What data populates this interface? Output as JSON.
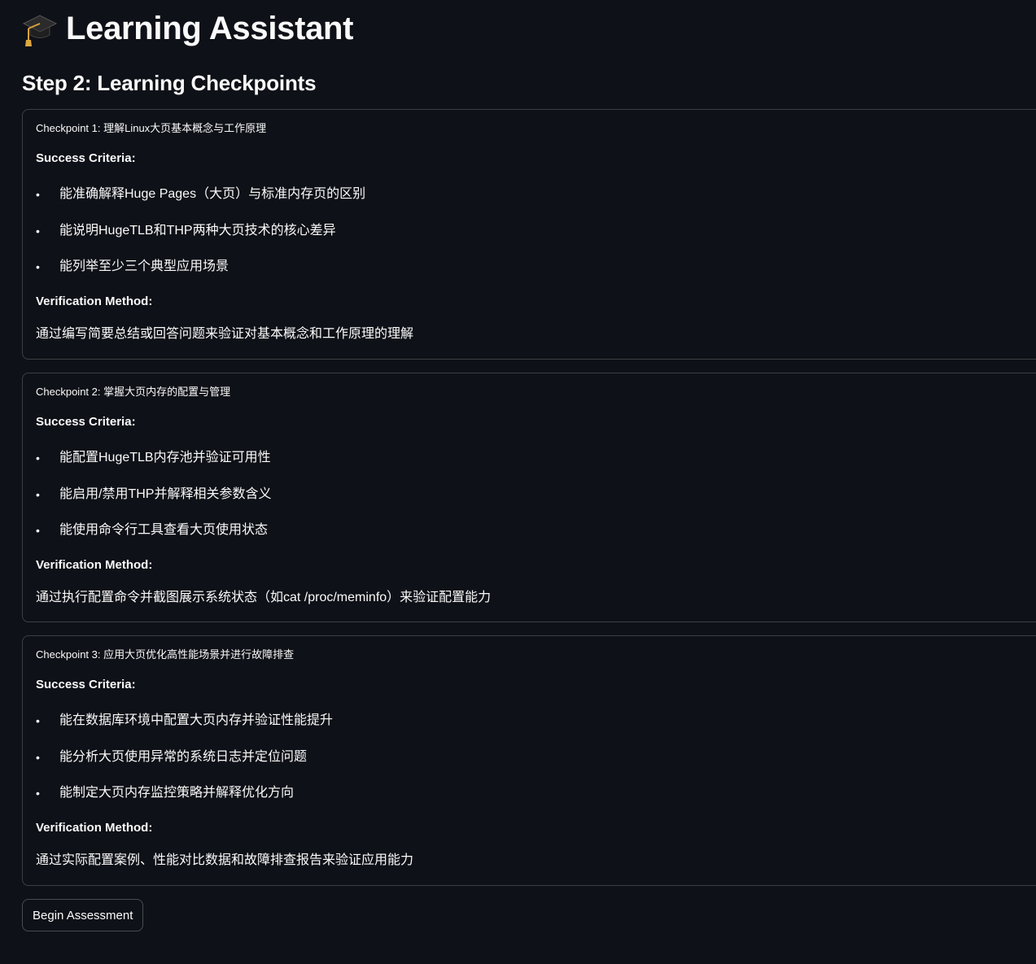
{
  "app": {
    "title": "Learning Assistant",
    "title_icon": "graduation-cap-icon"
  },
  "section": {
    "title": "Step 2: Learning Checkpoints"
  },
  "checkpoints": [
    {
      "title": "Checkpoint 1: 理解Linux大页基本概念与工作原理",
      "criteria_label": "Success Criteria:",
      "criteria": [
        "能准确解释Huge Pages（大页）与标准内存页的区别",
        "能说明HugeTLB和THP两种大页技术的核心差异",
        "能列举至少三个典型应用场景"
      ],
      "method_label": "Verification Method:",
      "method": "通过编写简要总结或回答问题来验证对基本概念和工作原理的理解"
    },
    {
      "title": "Checkpoint 2: 掌握大页内存的配置与管理",
      "criteria_label": "Success Criteria:",
      "criteria": [
        "能配置HugeTLB内存池并验证可用性",
        "能启用/禁用THP并解释相关参数含义",
        "能使用命令行工具查看大页使用状态"
      ],
      "method_label": "Verification Method:",
      "method": "通过执行配置命令并截图展示系统状态（如cat /proc/meminfo）来验证配置能力"
    },
    {
      "title": "Checkpoint 3: 应用大页优化高性能场景并进行故障排查",
      "criteria_label": "Success Criteria:",
      "criteria": [
        "能在数据库环境中配置大页内存并验证性能提升",
        "能分析大页使用异常的系统日志并定位问题",
        "能制定大页内存监控策略并解释优化方向"
      ],
      "method_label": "Verification Method:",
      "method": "通过实际配置案例、性能对比数据和故障排查报告来验证应用能力"
    }
  ],
  "actions": {
    "begin_label": "Begin Assessment"
  },
  "colors": {
    "background": "#0e1117",
    "text": "#fafafa",
    "border": "rgba(250,250,250,0.2)"
  }
}
